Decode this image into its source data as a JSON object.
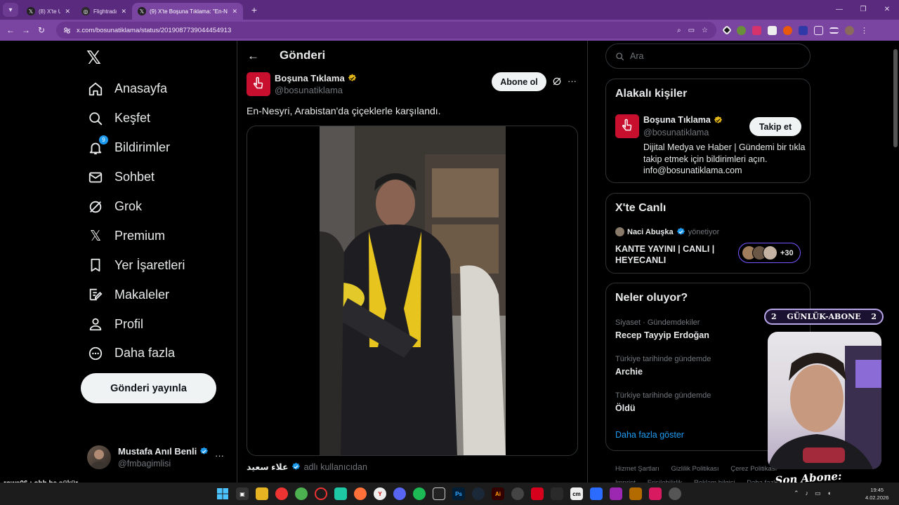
{
  "browser": {
    "tabs": [
      {
        "label": "(8) X'te U",
        "icon": "x-icon",
        "active": false
      },
      {
        "label": "Flightradar",
        "icon": "flightradar-icon",
        "active": false
      },
      {
        "label": "(9) X'te Boşuna Tıklama: \"En-Ne",
        "icon": "x-icon",
        "active": true
      }
    ],
    "url": "x.com/bosunatiklama/status/2019087739044454913"
  },
  "sidebar": {
    "items": [
      {
        "label": "Anasayfa",
        "icon": "home-icon"
      },
      {
        "label": "Keşfet",
        "icon": "search-icon"
      },
      {
        "label": "Bildirimler",
        "icon": "bell-icon",
        "badge": "9"
      },
      {
        "label": "Sohbet",
        "icon": "mail-icon"
      },
      {
        "label": "Grok",
        "icon": "grok-icon"
      },
      {
        "label": "Premium",
        "icon": "x-icon"
      },
      {
        "label": "Yer İşaretleri",
        "icon": "bookmark-icon"
      },
      {
        "label": "Makaleler",
        "icon": "article-icon"
      },
      {
        "label": "Profil",
        "icon": "person-icon"
      },
      {
        "label": "Daha fazla",
        "icon": "more-circle-icon"
      }
    ],
    "post_button": "Gönderi yayınla",
    "account": {
      "name": "Mustafa Anıl Benli",
      "handle": "@fmbagimlisi"
    }
  },
  "main": {
    "title": "Gönderi",
    "post": {
      "author": "Boşuna Tıklama",
      "handle": "@bosunatiklama",
      "subscribe_label": "Abone ol",
      "text": "En-Nesyri, Arabistan'da çiçeklerle karşılandı.",
      "attribution_name": "علاء سعيد",
      "attribution_suffix": "adlı kullanıcıdan"
    }
  },
  "right": {
    "search_placeholder": "Ara",
    "relevant": {
      "title": "Alakalı kişiler",
      "name": "Boşuna Tıklama",
      "handle": "@bosunatiklama",
      "follow_label": "Takip et",
      "bio": "Dijital Medya ve Haber | Gündemi bir tıkla takip etmek için bildirimleri açın. info@bosunatiklama.com"
    },
    "live": {
      "title": "X'te Canlı",
      "host": "Naci Abuşka",
      "host_role": "yönetiyor",
      "stream_title": "KANTE YAYINI | CANLI | HEYECANLI",
      "listener_extra": "+30"
    },
    "trends": {
      "title": "Neler oluyor?",
      "items": [
        {
          "context": "Siyaset · Gündemdekiler",
          "name": "Recep Tayyip Erdoğan"
        },
        {
          "context": "Türkiye tarihinde gündemde",
          "name": "Archie"
        },
        {
          "context": "Türkiye tarihinde gündemde",
          "name": "Öldü"
        }
      ],
      "show_more": "Daha fazla göster"
    },
    "footer": [
      "Hizmet Şartları",
      "Gizlilik Politikası",
      "Çerez Politikası",
      "Imprint",
      "Erişilebilirlik",
      "Reklam bilgisi",
      "Daha fazla"
    ]
  },
  "overlay": {
    "sub_banner": {
      "left": "2",
      "label": "GÜNLÜK-ABONE",
      "right": "2"
    },
    "sub_ticker": "Son Abone: cemgonte",
    "chat_line": "rows06 : ohh be şükür"
  },
  "taskbar": {
    "time": "19:45",
    "date": "4.02.2026"
  },
  "colors": {
    "accent": "#1d9bf0",
    "browser_tabbar": "#5a2a7e",
    "browser_toolbar": "#7a45a0",
    "brand_red": "#c8102e",
    "live_ring": "#7856ff"
  }
}
